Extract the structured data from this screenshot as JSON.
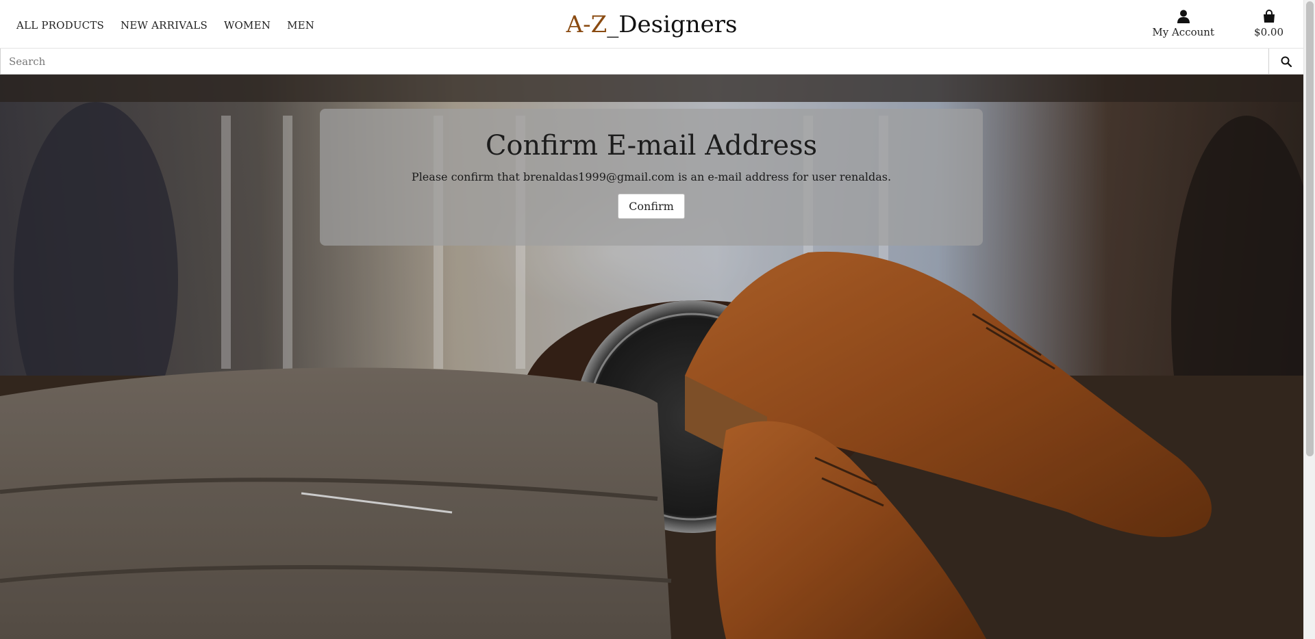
{
  "header": {
    "nav": [
      {
        "label": "ALL PRODUCTS"
      },
      {
        "label": "NEW ARRIVALS"
      },
      {
        "label": "WOMEN"
      },
      {
        "label": "MEN"
      }
    ],
    "brand": {
      "accent": "A-Z",
      "rest": "_Designers"
    },
    "account": {
      "label": "My Account",
      "icon": "user-icon"
    },
    "bag": {
      "label": "$0.00",
      "icon": "shopping-bag-icon"
    }
  },
  "search": {
    "placeholder": "Search",
    "value": "",
    "icon": "search-icon"
  },
  "confirm": {
    "title": "Confirm E-mail Address",
    "text_prefix": "Please confirm that ",
    "email": "brenaldas1999@gmail.com",
    "text_suffix": " is an e-mail address for user renaldas.",
    "button_label": "Confirm"
  },
  "colors": {
    "brand_accent": "#8a4b12",
    "card_background": "rgba(160,160,160,0.72)"
  }
}
